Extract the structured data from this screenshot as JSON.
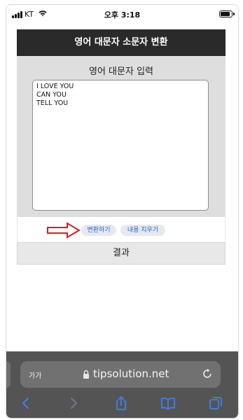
{
  "status_bar": {
    "carrier": "KT",
    "time": "오후 3:18"
  },
  "app": {
    "title": "영어 대문자 소문자 변환",
    "input_section_label": "영어 대문자 입력",
    "input_text": "I LOVE YOU\nCAN YOU\nTELL YOU",
    "convert_button": "변환하기",
    "clear_button": "내용 지우기",
    "result_label": "결과"
  },
  "browser": {
    "text_size_button": "가가",
    "url": "tipsolution.net",
    "toolbar": [
      "back-icon",
      "forward-icon",
      "share-icon",
      "bookmarks-icon",
      "tabs-icon"
    ]
  },
  "colors": {
    "header_bg": "#2a2a2a",
    "panel_bg": "#dedede",
    "button_text": "#2b64d8",
    "arrow": "#d42020",
    "safari_bar": "#545454",
    "toolbar_icon": "#3b82f6"
  }
}
